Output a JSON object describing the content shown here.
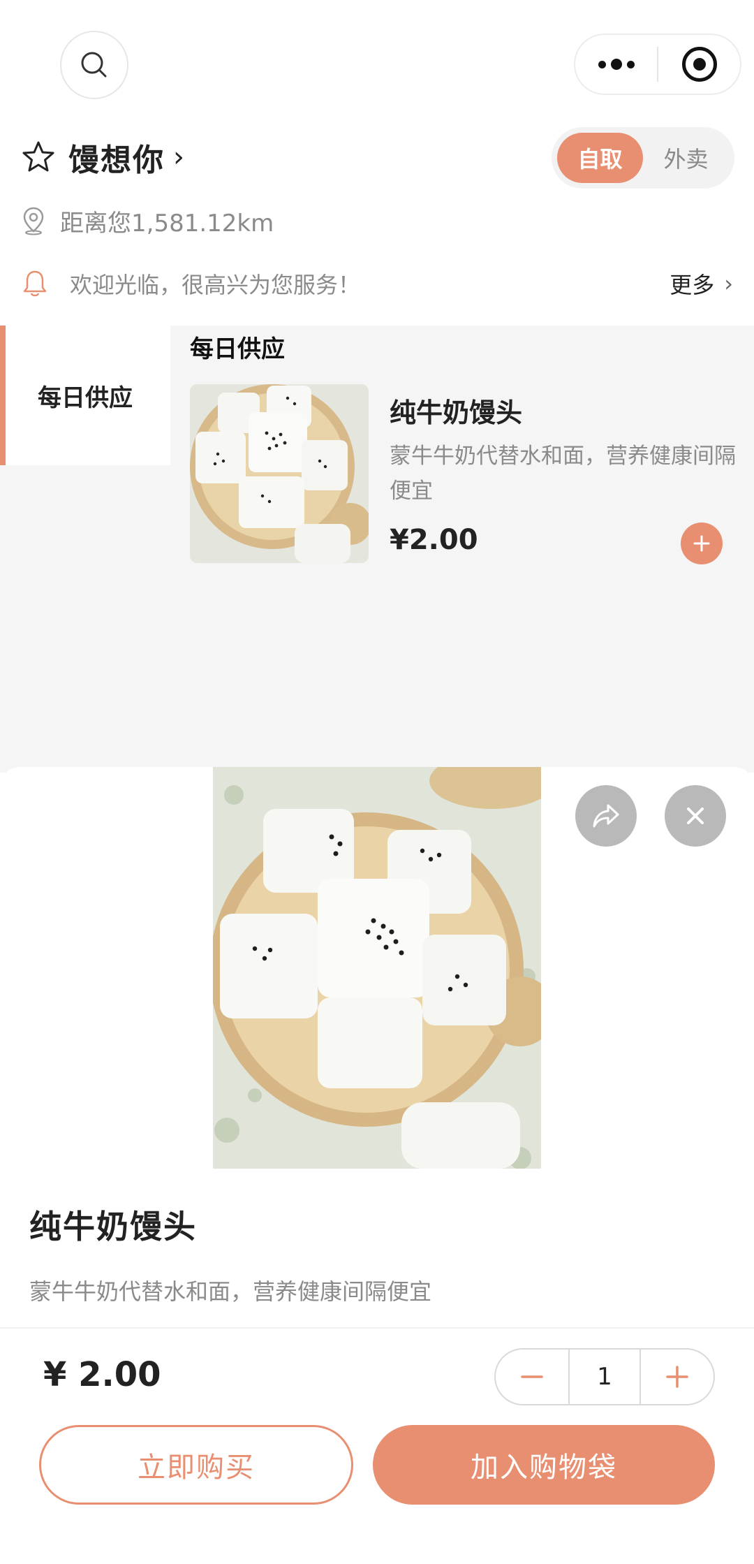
{
  "header": {
    "search_icon": "search-icon",
    "more_icon": "more-dots-icon",
    "close_app_icon": "target-icon"
  },
  "store": {
    "name": "馒想你",
    "favorite_icon": "star-icon",
    "modes": [
      {
        "label": "自取",
        "active": true
      },
      {
        "label": "外卖",
        "active": false
      }
    ],
    "distance": "距离您1,581.12km",
    "notice": "欢迎光临，很高兴为您服务！",
    "more_label": "更多"
  },
  "menu": {
    "categories": [
      {
        "label": "每日供应",
        "active": true
      }
    ],
    "section_title": "每日供应",
    "items": [
      {
        "name": "纯牛奶馒头",
        "description": "蒙牛牛奶代替水和面，营养健康间隔便宜",
        "price": "¥2.00"
      }
    ]
  },
  "detail": {
    "name": "纯牛奶馒头",
    "description": "蒙牛牛奶代替水和面，营养健康间隔便宜",
    "price": "¥ 2.00",
    "quantity": "1",
    "buy_now_label": "立即购买",
    "add_to_bag_label": "加入购物袋"
  },
  "colors": {
    "accent": "#e98f71",
    "muted_text": "#8a8a8a",
    "background_grey": "#f5f5f5"
  }
}
